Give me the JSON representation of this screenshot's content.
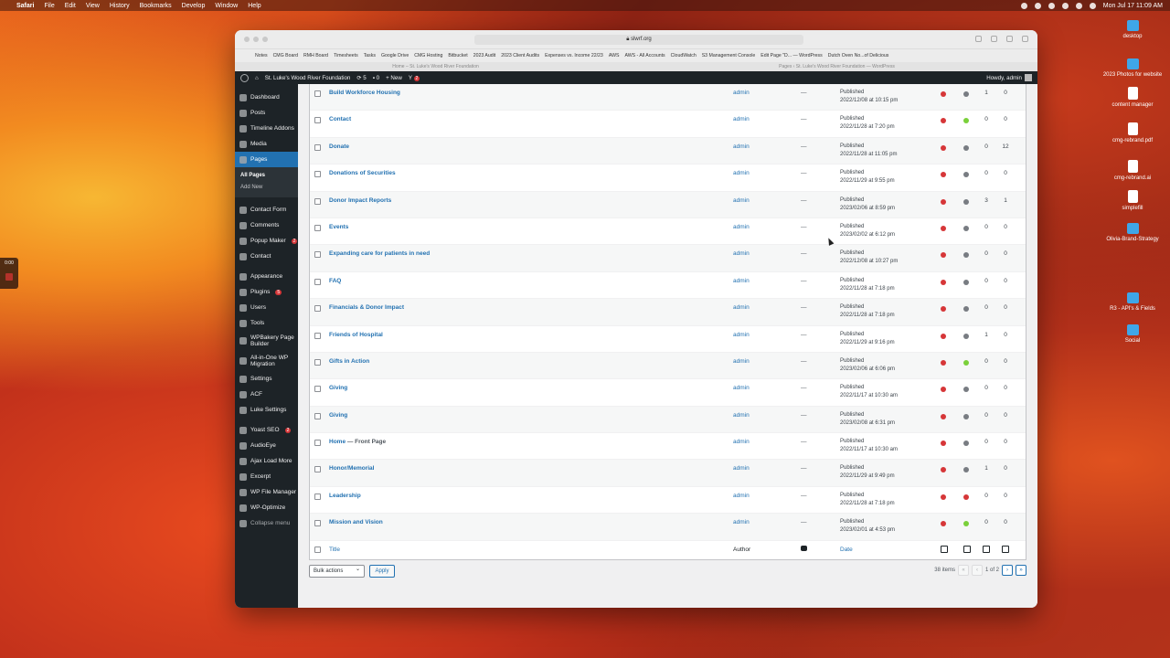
{
  "menubar": {
    "app": "Safari",
    "items": [
      "File",
      "Edit",
      "View",
      "History",
      "Bookmarks",
      "Develop",
      "Window",
      "Help"
    ],
    "clock": "Mon Jul 17  11:09 AM"
  },
  "desktop": {
    "icons": [
      {
        "label": "desktop",
        "kind": "folder"
      },
      {
        "label": "2023 Photos for website",
        "kind": "folder"
      },
      {
        "label": "content manager",
        "kind": "doc"
      },
      {
        "label": "cmg-rebrand.pdf",
        "kind": "doc"
      },
      {
        "label": "cmg-rebrand.ai",
        "kind": "doc"
      },
      {
        "label": "simplefill",
        "kind": "doc"
      },
      {
        "label": "Olivia-Brand-Strategy",
        "kind": "folder"
      },
      {
        "label": "R3 - API's & Fields",
        "kind": "folder"
      },
      {
        "label": "Social",
        "kind": "folder"
      }
    ],
    "widget_time": "0:00"
  },
  "browser": {
    "url": "slwrf.org",
    "bookmarks": [
      "Notes",
      "CMG Board",
      "RMH Board",
      "Timesheets",
      "Tasks",
      "Google Drive",
      "CMG Hosting",
      "Bitbucket",
      "2023 Audit",
      "2023 Client Audits",
      "Expenses vs. Income 22/23",
      "AWS",
      "AWS - All Accounts",
      "CloudWatch",
      "S3 Management Console",
      "Edit Page \"D... — WordPress",
      "Dutch Oven No...of Delicious"
    ],
    "tabs": [
      "Home – St. Luke's Wood River Foundation",
      "Pages ‹ St. Luke's Wood River Foundation — WordPress"
    ]
  },
  "adminbar": {
    "site": "St. Luke's Wood River Foundation",
    "updates": "5",
    "comments": "0",
    "new": "New",
    "yoast_count": "2",
    "howdy": "Howdy, admin"
  },
  "sidebar": {
    "items": [
      {
        "label": "Dashboard",
        "icon": "dashboard-icon"
      },
      {
        "label": "Posts",
        "icon": "pin-icon"
      },
      {
        "label": "Timeline Addons",
        "icon": "timeline-icon"
      },
      {
        "label": "Media",
        "icon": "media-icon"
      },
      {
        "label": "Pages",
        "icon": "pages-icon"
      }
    ],
    "submenu": [
      "All Pages",
      "Add New"
    ],
    "items2": [
      {
        "label": "Contact Form",
        "icon": "form-icon"
      },
      {
        "label": "Comments",
        "icon": "comment-icon"
      },
      {
        "label": "Popup Maker",
        "icon": "popup-icon",
        "count": "2"
      },
      {
        "label": "Contact",
        "icon": "mail-icon"
      }
    ],
    "items3": [
      {
        "label": "Appearance",
        "icon": "brush-icon"
      },
      {
        "label": "Plugins",
        "icon": "plugin-icon",
        "count": "5"
      },
      {
        "label": "Users",
        "icon": "user-icon"
      },
      {
        "label": "Tools",
        "icon": "wrench-icon"
      },
      {
        "label": "WPBakery Page Builder",
        "icon": "builder-icon"
      },
      {
        "label": "All-in-One WP Migration",
        "icon": "migration-icon"
      },
      {
        "label": "Settings",
        "icon": "settings-icon"
      },
      {
        "label": "ACF",
        "icon": "acf-icon"
      },
      {
        "label": "Luke Settings",
        "icon": "gear-icon"
      }
    ],
    "items4": [
      {
        "label": "Yoast SEO",
        "icon": "yoast-icon",
        "count": "2"
      },
      {
        "label": "AudioEye",
        "icon": "eye-icon"
      },
      {
        "label": "Ajax Load More",
        "icon": "ajax-icon"
      },
      {
        "label": "Excerpt",
        "icon": "excerpt-icon"
      },
      {
        "label": "WP File Manager",
        "icon": "folder-icon"
      },
      {
        "label": "WP-Optimize",
        "icon": "optimize-icon"
      },
      {
        "label": "Collapse menu",
        "icon": "collapse-icon"
      }
    ]
  },
  "table": {
    "rows": [
      {
        "title": "Build Workforce Housing",
        "suffix": "",
        "author": "admin",
        "tags": "—",
        "status": "Published",
        "date": "2022/12/08 at 10:15 pm",
        "seo": "#d63638",
        "read": "#787c82",
        "links": "1",
        "inlinks": "0"
      },
      {
        "title": "Contact",
        "suffix": "",
        "author": "admin",
        "tags": "—",
        "status": "Published",
        "date": "2022/11/28 at 7:20 pm",
        "seo": "#d63638",
        "read": "#7ad03a",
        "links": "0",
        "inlinks": "0"
      },
      {
        "title": "Donate",
        "suffix": "",
        "author": "admin",
        "tags": "—",
        "status": "Published",
        "date": "2022/11/28 at 11:05 pm",
        "seo": "#d63638",
        "read": "#787c82",
        "links": "0",
        "inlinks": "12"
      },
      {
        "title": "Donations of Securities",
        "suffix": "",
        "author": "admin",
        "tags": "—",
        "status": "Published",
        "date": "2022/11/29 at 9:55 pm",
        "seo": "#d63638",
        "read": "#787c82",
        "links": "0",
        "inlinks": "0"
      },
      {
        "title": "Donor Impact Reports",
        "suffix": "",
        "author": "admin",
        "tags": "—",
        "status": "Published",
        "date": "2023/02/06 at 8:59 pm",
        "seo": "#d63638",
        "read": "#787c82",
        "links": "3",
        "inlinks": "1"
      },
      {
        "title": "Events",
        "suffix": "",
        "author": "admin",
        "tags": "—",
        "status": "Published",
        "date": "2023/02/02 at 6:12 pm",
        "seo": "#d63638",
        "read": "#787c82",
        "links": "0",
        "inlinks": "0"
      },
      {
        "title": "Expanding care for patients in need",
        "suffix": "",
        "author": "admin",
        "tags": "—",
        "status": "Published",
        "date": "2022/12/08 at 10:27 pm",
        "seo": "#d63638",
        "read": "#787c82",
        "links": "0",
        "inlinks": "0"
      },
      {
        "title": "FAQ",
        "suffix": "",
        "author": "admin",
        "tags": "—",
        "status": "Published",
        "date": "2022/11/28 at 7:18 pm",
        "seo": "#d63638",
        "read": "#787c82",
        "links": "0",
        "inlinks": "0"
      },
      {
        "title": "Financials & Donor Impact",
        "suffix": "",
        "author": "admin",
        "tags": "—",
        "status": "Published",
        "date": "2022/11/28 at 7:18 pm",
        "seo": "#d63638",
        "read": "#787c82",
        "links": "0",
        "inlinks": "0"
      },
      {
        "title": "Friends of Hospital",
        "suffix": "",
        "author": "admin",
        "tags": "—",
        "status": "Published",
        "date": "2022/11/29 at 9:16 pm",
        "seo": "#d63638",
        "read": "#787c82",
        "links": "1",
        "inlinks": "0"
      },
      {
        "title": "Gifts in Action",
        "suffix": "",
        "author": "admin",
        "tags": "—",
        "status": "Published",
        "date": "2023/02/06 at 6:06 pm",
        "seo": "#d63638",
        "read": "#7ad03a",
        "links": "0",
        "inlinks": "0"
      },
      {
        "title": "Giving",
        "suffix": "",
        "author": "admin",
        "tags": "—",
        "status": "Published",
        "date": "2022/11/17 at 10:30 am",
        "seo": "#d63638",
        "read": "#787c82",
        "links": "0",
        "inlinks": "0"
      },
      {
        "title": "Giving",
        "suffix": "",
        "author": "admin",
        "tags": "—",
        "status": "Published",
        "date": "2023/02/08 at 6:31 pm",
        "seo": "#d63638",
        "read": "#787c82",
        "links": "0",
        "inlinks": "0"
      },
      {
        "title": "Home",
        "suffix": " — Front Page",
        "author": "admin",
        "tags": "—",
        "status": "Published",
        "date": "2022/11/17 at 10:30 am",
        "seo": "#d63638",
        "read": "#787c82",
        "links": "0",
        "inlinks": "0"
      },
      {
        "title": "Honor/Memorial",
        "suffix": "",
        "author": "admin",
        "tags": "—",
        "status": "Published",
        "date": "2022/11/29 at 9:49 pm",
        "seo": "#d63638",
        "read": "#787c82",
        "links": "1",
        "inlinks": "0"
      },
      {
        "title": "Leadership",
        "suffix": "",
        "author": "admin",
        "tags": "—",
        "status": "Published",
        "date": "2022/11/28 at 7:18 pm",
        "seo": "#d63638",
        "read": "#d63638",
        "links": "0",
        "inlinks": "0"
      },
      {
        "title": "Mission and Vision",
        "suffix": "",
        "author": "admin",
        "tags": "—",
        "status": "Published",
        "date": "2023/02/01 at 4:53 pm",
        "seo": "#d63638",
        "read": "#7ad03a",
        "links": "0",
        "inlinks": "0"
      }
    ],
    "footer": {
      "title": "Title",
      "author": "Author",
      "date": "Date"
    }
  },
  "tablenav": {
    "bulk": "Bulk actions",
    "apply": "Apply",
    "items": "38 items",
    "first": "«",
    "prev": "‹",
    "page": "1 of 2",
    "next": "›",
    "last": "»"
  }
}
